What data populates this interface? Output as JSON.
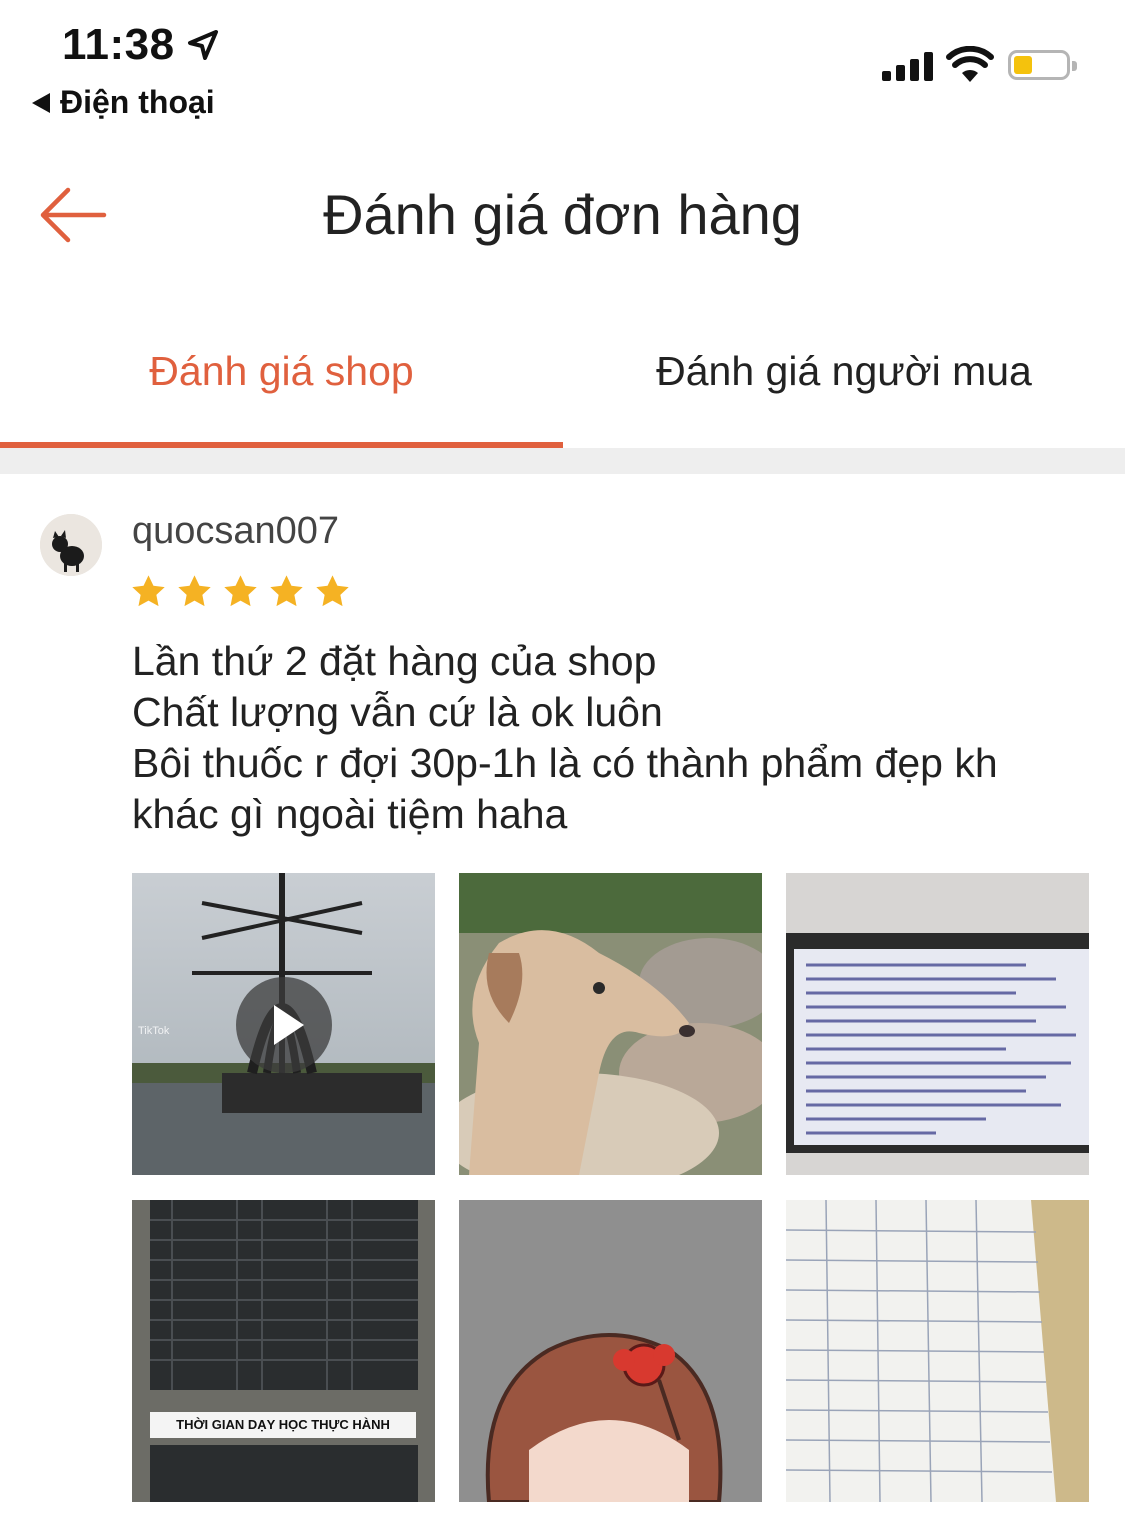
{
  "status_bar": {
    "time": "11:38",
    "back_app": "Điện thoại"
  },
  "header": {
    "title": "Đánh giá đơn hàng"
  },
  "tabs": [
    {
      "label": "Đánh giá shop",
      "active": true
    },
    {
      "label": "Đánh giá người mua",
      "active": false
    }
  ],
  "colors": {
    "accent": "#e0603e",
    "star": "#f5b223"
  },
  "review": {
    "username": "quocsan007",
    "rating": 5,
    "lines": [
      "Lần thứ 2 đặt hàng của shop",
      "Chất lượng vẫn cứ là ok luôn",
      "Bôi thuốc r đợi 30p-1h là có thành phẩm đẹp kh",
      "khác gì ngoài tiệm haha"
    ],
    "media": [
      {
        "kind": "video",
        "overlay_text": "TikTok"
      },
      {
        "kind": "image"
      },
      {
        "kind": "image"
      },
      {
        "kind": "image",
        "overlay_text": "THỜI GIAN DẠY HỌC THỰC HÀNH"
      },
      {
        "kind": "image"
      },
      {
        "kind": "image"
      }
    ]
  }
}
